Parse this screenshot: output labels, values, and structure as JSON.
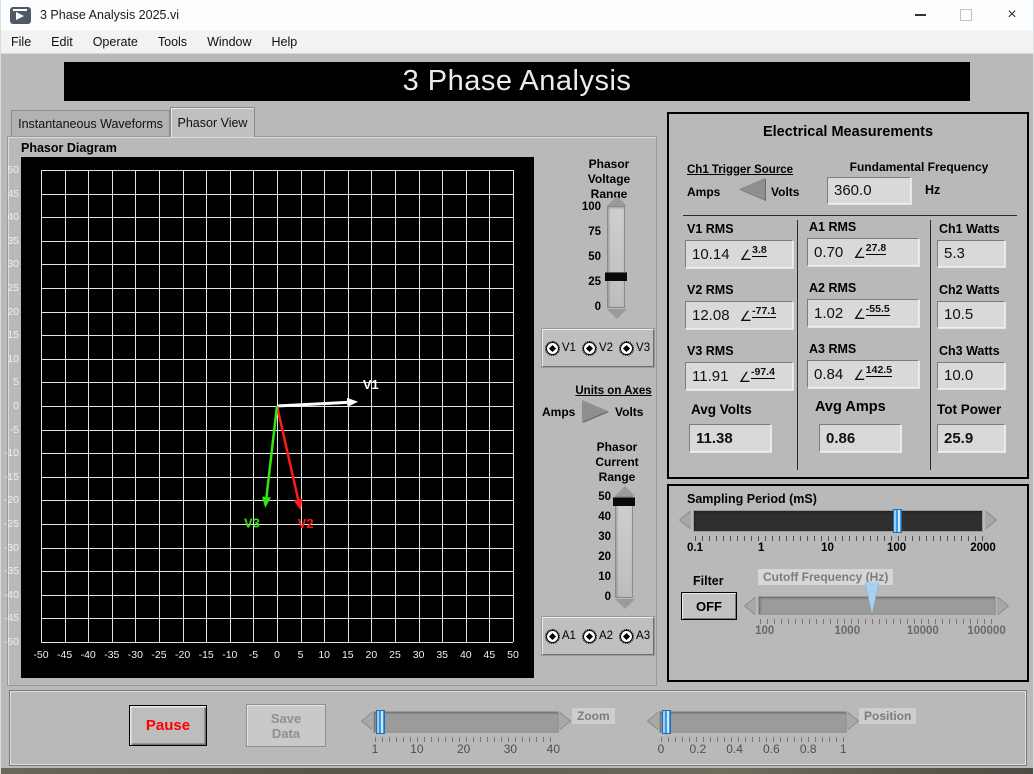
{
  "window": {
    "title": "3 Phase Analysis 2025.vi",
    "close_glyph": "×"
  },
  "menu": {
    "items": [
      "File",
      "Edit",
      "Operate",
      "Tools",
      "Window",
      "Help"
    ]
  },
  "banner": {
    "title": "3 Phase Analysis"
  },
  "tabs": {
    "inactive": "Instantaneous Waveforms",
    "active": "Phasor View"
  },
  "colors": {
    "accent_blue": "#3f97e0",
    "v1": "#ffffff",
    "v2": "#ff1a1a",
    "v3": "#33e60f",
    "pause_red": "#ff0000"
  },
  "chart_data": {
    "type": "scatter",
    "title": "Phasor Diagram",
    "xlabel": "",
    "ylabel": "",
    "xlim": [
      -50,
      50
    ],
    "ylim": [
      -50,
      50
    ],
    "tick_step": 5,
    "grid": true,
    "units": "Volts",
    "series": [
      {
        "name": "V1",
        "color": "#ffffff",
        "from": [
          0,
          0
        ],
        "to": [
          17.2,
          0.9
        ],
        "label_pos": [
          18.2,
          3.6
        ],
        "width": 3
      },
      {
        "name": "V2",
        "color": "#ff1a1a",
        "from": [
          0,
          0
        ],
        "to": [
          5.0,
          -22.1
        ],
        "label_pos": [
          4.4,
          -25.9
        ],
        "width": 2.5
      },
      {
        "name": "V3",
        "color": "#33e60f",
        "from": [
          0,
          0
        ],
        "to": [
          -2.5,
          -21.6
        ],
        "label_pos": [
          -7.0,
          -25.7
        ],
        "width": 2.5
      }
    ]
  },
  "plot": {
    "label": "Phasor Diagram"
  },
  "voltage_range": {
    "title": "Phasor\nVoltage\nRange",
    "ticks": [
      "100",
      "75",
      "50",
      "25",
      "0"
    ],
    "fraction": 0.27
  },
  "current_range": {
    "title": "Phasor\nCurrent\nRange",
    "ticks": [
      "50",
      "40",
      "30",
      "20",
      "10",
      "0"
    ],
    "fraction": 1.0
  },
  "voltage_channels": [
    "V1",
    "V2",
    "V3"
  ],
  "current_channels": [
    "A1",
    "A2",
    "A3"
  ],
  "units_toggle": {
    "label": "Units on Axes",
    "left": "Amps",
    "right": "Volts"
  },
  "measurements": {
    "title": "Electrical Measurements",
    "trigger": {
      "label": "Ch1 Trigger Source",
      "left": "Amps",
      "right": "Volts"
    },
    "fundamental": {
      "label": "Fundamental Frequency",
      "value": "360.0",
      "unit": "Hz"
    },
    "angle_symbol": "∠",
    "v_rms": [
      {
        "label": "V1 RMS",
        "value": "10.14",
        "angle": "3.8"
      },
      {
        "label": "V2 RMS",
        "value": "12.08",
        "angle": "-77.1"
      },
      {
        "label": "V3 RMS",
        "value": "11.91",
        "angle": "-97.4"
      }
    ],
    "a_rms": [
      {
        "label": "A1 RMS",
        "value": "0.70",
        "angle": "27.8"
      },
      {
        "label": "A2 RMS",
        "value": "1.02",
        "angle": "-55.5"
      },
      {
        "label": "A3 RMS",
        "value": "0.84",
        "angle": "142.5"
      }
    ],
    "watts": [
      {
        "label": "Ch1 Watts",
        "value": "5.3"
      },
      {
        "label": "Ch2 Watts",
        "value": "10.5"
      },
      {
        "label": "Ch3 Watts",
        "value": "10.0"
      }
    ],
    "avg_volts": {
      "label": "Avg Volts",
      "value": "11.38"
    },
    "avg_amps": {
      "label": "Avg Amps",
      "value": "0.86"
    },
    "tot_power": {
      "label": "Tot Power",
      "value": "25.9"
    }
  },
  "sampling": {
    "label": "Sampling Period (mS)",
    "scale": [
      "0.1",
      "1",
      "10",
      "100",
      "2000"
    ],
    "scale_pos": [
      0.0,
      0.23,
      0.46,
      0.7,
      1.0
    ],
    "fraction": 0.72
  },
  "filter": {
    "label": "Filter",
    "state": "OFF"
  },
  "cutoff": {
    "label": "Cutoff Frequency (Hz)",
    "scale": [
      "100",
      "1000",
      "10000",
      "100000"
    ],
    "scale_pos": [
      0.02,
      0.37,
      0.69,
      0.96
    ],
    "fraction": 0.48
  },
  "bottom": {
    "pause": "Pause",
    "save": "Save\nData",
    "zoom": {
      "label": "Zoom",
      "scale": [
        "1",
        "10",
        "20",
        "30",
        "40"
      ],
      "scale_pos": [
        0.0,
        0.23,
        0.487,
        0.744,
        0.98
      ],
      "fraction": 0.01
    },
    "position": {
      "label": "Position",
      "scale": [
        "0",
        "0.2",
        "0.4",
        "0.6",
        "0.8",
        "1"
      ],
      "scale_pos": [
        0.0,
        0.2,
        0.4,
        0.6,
        0.8,
        0.99
      ],
      "fraction": 0.01
    }
  }
}
